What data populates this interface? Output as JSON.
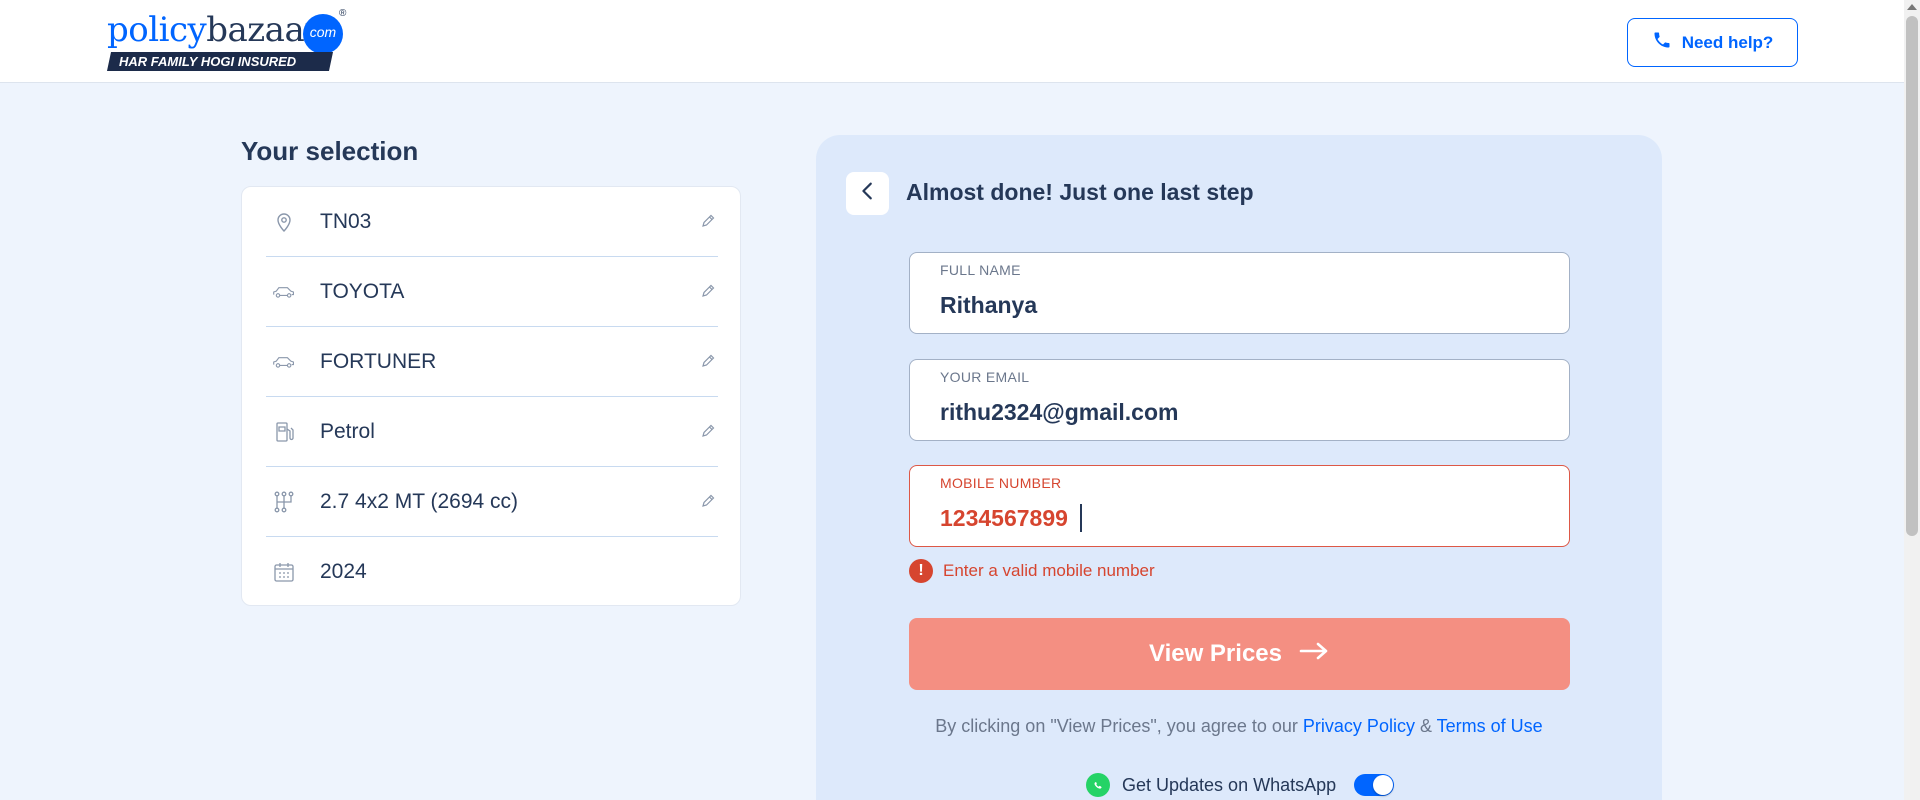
{
  "brand": {
    "name_part1": "policy",
    "name_part2": "bazaar",
    "dot": "com",
    "reg": "®",
    "tagline": "HAR FAMILY HOGI INSURED"
  },
  "header": {
    "help_label": "Need help?"
  },
  "selection": {
    "title": "Your selection",
    "items": [
      {
        "icon": "location-icon",
        "label": "TN03",
        "editable": true
      },
      {
        "icon": "car-icon",
        "label": "TOYOTA",
        "editable": true
      },
      {
        "icon": "car-icon",
        "label": "FORTUNER",
        "editable": true
      },
      {
        "icon": "fuel-icon",
        "label": "Petrol",
        "editable": true
      },
      {
        "icon": "gearbox-icon",
        "label": "2.7 4x2 MT (2694 cc)",
        "editable": true
      },
      {
        "icon": "calendar-icon",
        "label": "2024",
        "editable": false
      }
    ]
  },
  "form": {
    "title": "Almost done! Just one last step",
    "full_name": {
      "label": "FULL NAME",
      "value": "Rithanya"
    },
    "email": {
      "label": "YOUR EMAIL",
      "value": "rithu2324@gmail.com"
    },
    "mobile": {
      "label": "MOBILE NUMBER",
      "value": "1234567899",
      "error": "Enter a valid mobile number"
    },
    "cta_label": "View Prices",
    "terms": {
      "prefix": "By clicking on \"View Prices\", you agree to our",
      "privacy": "Privacy Policy",
      "amp": "&",
      "terms": "Terms of Use"
    },
    "whatsapp": {
      "label": "Get Updates on WhatsApp",
      "enabled": true
    }
  },
  "colors": {
    "brand_blue": "#0065ff",
    "error_red": "#d6452f",
    "cta_disabled": "#f48f82",
    "page_bg": "#eef4fd",
    "form_bg": "#dde9fb"
  }
}
